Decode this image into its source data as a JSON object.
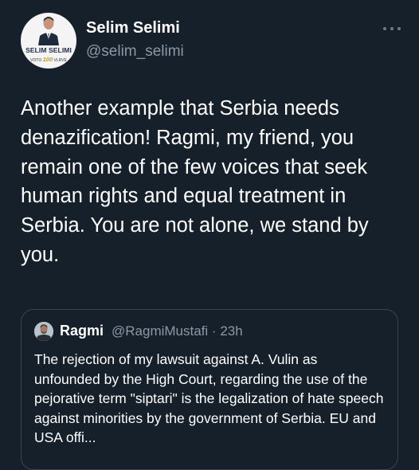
{
  "tweet": {
    "author": {
      "display_name": "Selim Selimi",
      "handle": "@selim_selimi",
      "avatar_badge": "SELIM SELIMI",
      "avatar_caption_left": "VOTO",
      "avatar_caption_num": "100",
      "avatar_caption_right": "VLRVE"
    },
    "more_icon": "more-horizontal-icon",
    "text": "Another example that Serbia needs denazification! Ragmi, my friend, you remain one of the few voices that seek human rights and equal treatment in Serbia. You are not alone, we stand by you."
  },
  "quoted_tweet": {
    "author": {
      "display_name": "Ragmi",
      "handle": "@RagmiMustafi",
      "separator": "·",
      "time": "23h"
    },
    "text": "The rejection of my lawsuit against A. Vulin as unfounded by the High Court, regarding the use of the pejorative term \"siptari\" is the legalization of hate speech against minorities by the government of Serbia. EU and USA offi..."
  },
  "colors": {
    "background": "#15202b",
    "text_primary": "#ffffff",
    "text_secondary": "#8b98a5",
    "border": "#38444d"
  }
}
